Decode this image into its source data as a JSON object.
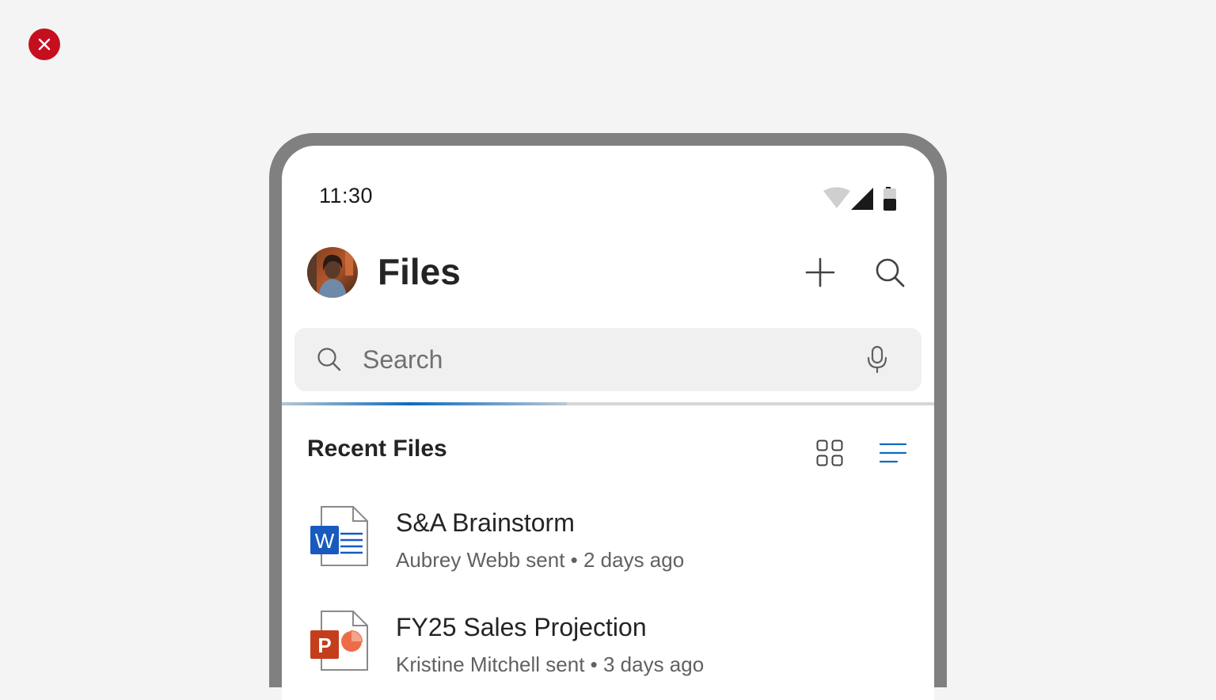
{
  "close_button": {
    "icon": "close-icon",
    "color": "#c50f1f"
  },
  "status_bar": {
    "time": "11:30",
    "icons": [
      "wifi-icon",
      "cellular-signal-icon",
      "battery-icon"
    ]
  },
  "header": {
    "title": "Files",
    "avatar": "user-avatar",
    "actions": [
      "add-icon",
      "search-icon"
    ]
  },
  "search": {
    "placeholder": "Search",
    "value": "",
    "icons": [
      "search-icon",
      "microphone-icon"
    ]
  },
  "loading": {
    "progress_color": "#0f6cbd"
  },
  "recent": {
    "title": "Recent Files",
    "view_options": [
      "grid-view-icon",
      "list-view-icon"
    ],
    "active_view": "list",
    "accent": "#0f6cbd"
  },
  "files": [
    {
      "name": "S&A Brainstorm",
      "meta": "Aubrey Webb sent • 2 days ago",
      "type": "word-document-icon",
      "color": "#185abd"
    },
    {
      "name": "FY25 Sales Projection",
      "meta": "Kristine Mitchell sent • 3 days ago",
      "type": "powerpoint-document-icon",
      "color": "#c43e1c"
    }
  ]
}
